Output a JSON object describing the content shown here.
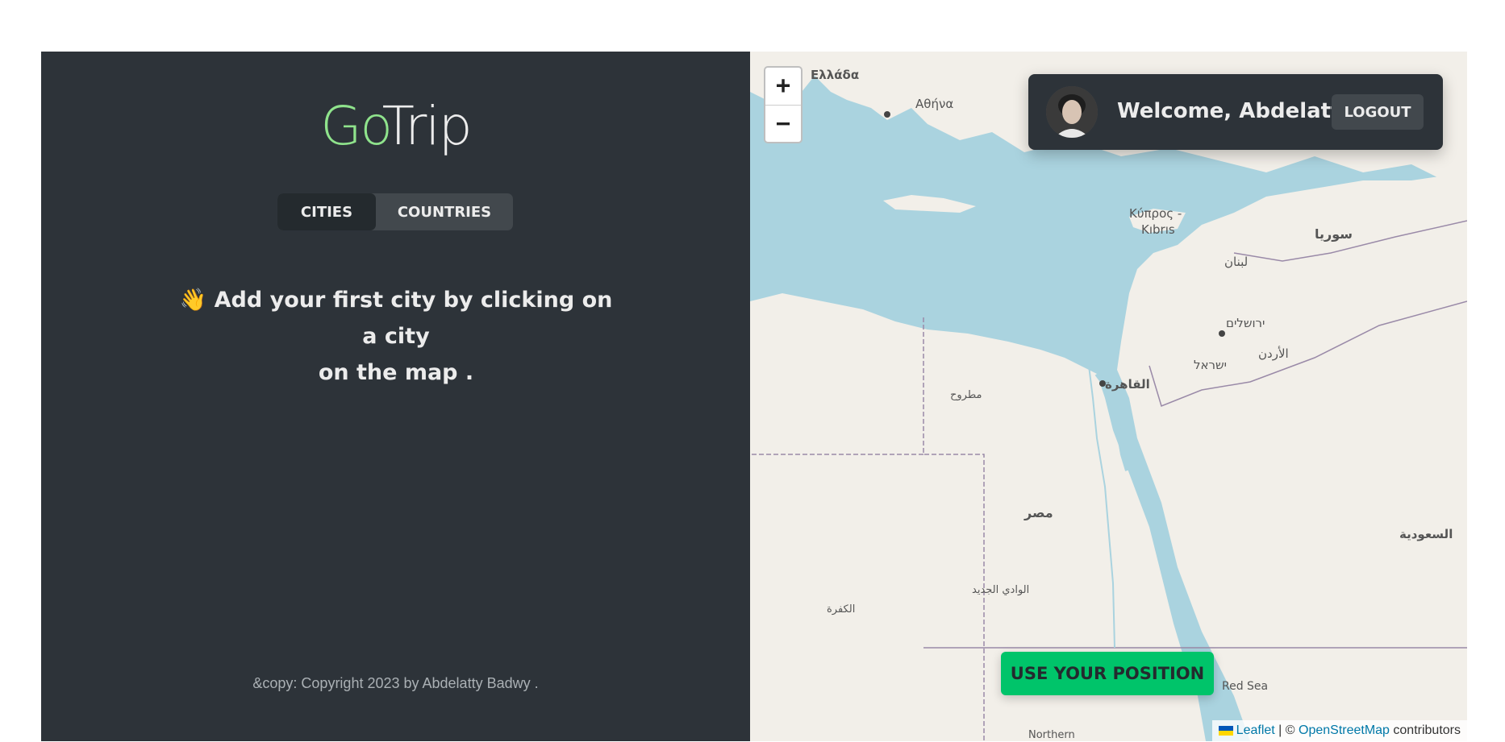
{
  "sidebar": {
    "logo_go": "Go",
    "logo_trip": "Trip",
    "tabs": [
      {
        "label": "CITIES",
        "active": true
      },
      {
        "label": "COUNTRIES",
        "active": false
      }
    ],
    "message_line1": "👋 Add your first city by clicking on a city",
    "message_line2": "on the map .",
    "copyright": "&copy: Copyright 2023 by Abdelatty Badwy ."
  },
  "map": {
    "zoom_in": "+",
    "zoom_out": "−",
    "user": {
      "welcome": "Welcome, Abdelatty",
      "logout": "LOGOUT"
    },
    "position_button": "USE YOUR POSITION",
    "attribution": {
      "leaflet": "Leaflet",
      "separator": " | © ",
      "osm": "OpenStreetMap",
      "contributors": " contributors"
    },
    "place_labels": {
      "greece": "Ελλάδα",
      "athens": "Αθήνα",
      "cyprus1": "Κύπρος -",
      "cyprus2": "Kıbrıs",
      "syria": "سوريا",
      "lebanon": "لبنان",
      "jerusalem": "ירושלים",
      "israel": "ישראל",
      "jordan": "الأردن",
      "cairo": "القاهرة",
      "egypt": "مصر",
      "saudi": "السعودية",
      "red_sea": "Red Sea",
      "matrouh": "مطروح",
      "wadi_gedid": "الوادي الجديد",
      "kufra": "الكفرة",
      "northern": "Northern"
    }
  },
  "colors": {
    "sidebar_bg": "#2d3339",
    "accent_green": "#8fe38c",
    "button_green": "#00c46a",
    "sea": "#aad3df",
    "land": "#f2efe9"
  }
}
